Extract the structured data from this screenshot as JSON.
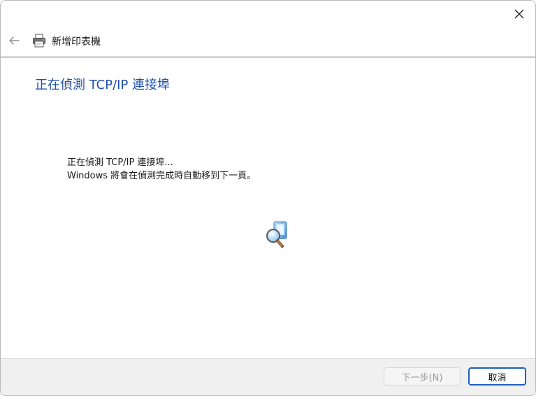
{
  "window": {
    "title": "新增印表機",
    "title_icon": "printer-icon",
    "close_icon": "close-icon",
    "back_icon": "back-arrow-icon"
  },
  "main": {
    "heading": "正在偵測 TCP/IP 連接埠",
    "line1": "正在偵測 TCP/IP 連接埠...",
    "line2": "Windows 將會在偵測完成時自動移到下一頁。",
    "animation_icon": "search-magnifier-icon"
  },
  "footer": {
    "next_label": "下一步(N)",
    "next_enabled": false,
    "cancel_label": "取消"
  },
  "colors": {
    "heading": "#1f4fa8",
    "accent": "#1f5fbf",
    "footer_bg": "#f0f0f0",
    "disabled_text": "#9a9a9a"
  }
}
